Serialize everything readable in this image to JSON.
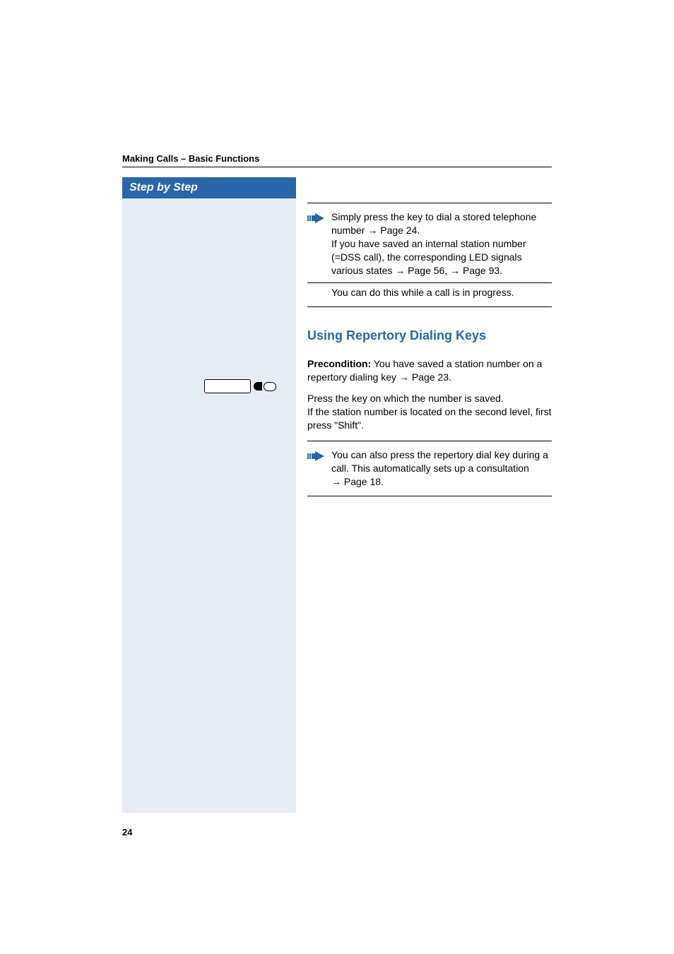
{
  "header": {
    "running_head": "Making Calls – Basic Functions"
  },
  "sidebar": {
    "title": "Step by Step"
  },
  "note1": {
    "line1a": "Simply press the key to dial a stored telephone number ",
    "line1b": " Page 24.",
    "line2": "If you have saved an internal station number (=DSS call), the corresponding LED signals various states ",
    "line2b": " Page 56, ",
    "line2c": " Page 93.",
    "line3": "You can do this while a call is in progress."
  },
  "section": {
    "heading": "Using Repertory Dialing Keys",
    "precondition_label": "Precondition:",
    "precondition_text": " You have saved a station number on a repertory dialing key ",
    "precondition_page": " Page 23.",
    "press_key": "Press the key on which the number is saved.",
    "second_level": "If the station number is located on the second level, first press \"Shift\"."
  },
  "note2": {
    "text1": "You can also press the repertory dial key during a call. This automatically sets up a consultation ",
    "text2": " Page 18."
  },
  "footer": {
    "page_number": "24"
  },
  "glyphs": {
    "arrow": "→"
  }
}
